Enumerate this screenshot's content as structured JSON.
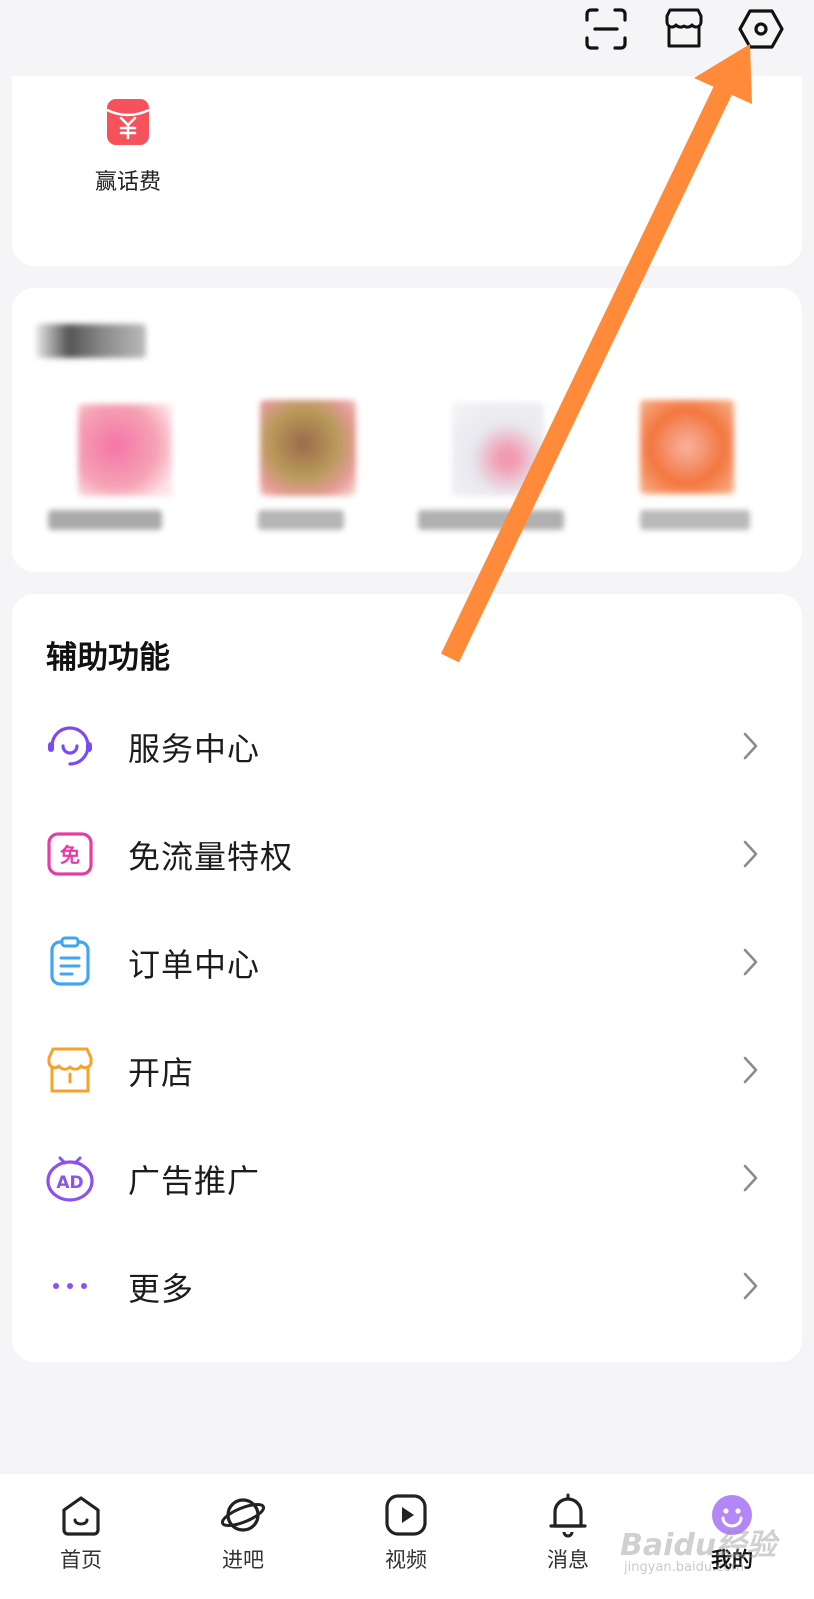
{
  "top_bar": {
    "icons": [
      "scan-icon",
      "shop-icon",
      "settings-icon"
    ]
  },
  "recharge": {
    "label": "赢话费",
    "icon": "red-envelope-icon",
    "color": "#f5525c"
  },
  "blurred_section": {
    "note": ""
  },
  "assist": {
    "title": "辅助功能",
    "items": [
      {
        "label": "服务中心",
        "icon": "headset-icon",
        "color": "#7a4cf0"
      },
      {
        "label": "免流量特权",
        "icon": "free-data-icon",
        "color": "#e73ca6"
      },
      {
        "label": "订单中心",
        "icon": "clipboard-icon",
        "color": "#41a6f2"
      },
      {
        "label": "开店",
        "icon": "store-icon",
        "color": "#f5a12b"
      },
      {
        "label": "广告推广",
        "icon": "ad-icon",
        "color": "#8a52ee"
      },
      {
        "label": "更多",
        "icon": "more-dots-icon",
        "color": "#8a52ee"
      }
    ]
  },
  "bottom_nav": {
    "items": [
      {
        "label": "首页",
        "icon": "home-icon",
        "active": false
      },
      {
        "label": "进吧",
        "icon": "planet-icon",
        "active": false
      },
      {
        "label": "视频",
        "icon": "video-play-icon",
        "active": false
      },
      {
        "label": "消息",
        "icon": "bell-icon",
        "active": false
      },
      {
        "label": "我的",
        "icon": "smile-face-icon",
        "active": true
      }
    ]
  },
  "colors": {
    "accent": "#8a52ee",
    "arrow": "#ff8a3a",
    "background": "#f5f5f7"
  },
  "watermark": {
    "text": "Baidu经验",
    "sub": "jingyan.baidu.com"
  }
}
